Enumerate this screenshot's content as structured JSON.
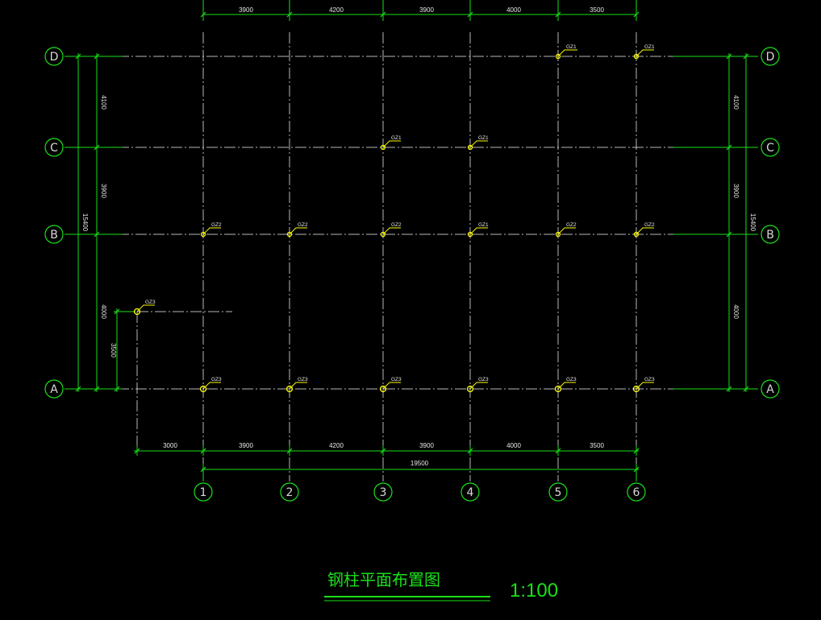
{
  "title": "钢柱平面布置图",
  "scale": "1:100",
  "axes_x": [
    "1",
    "2",
    "3",
    "4",
    "5",
    "6"
  ],
  "axes_y": [
    "A",
    "B",
    "C",
    "D"
  ],
  "dims_x": [
    "3900",
    "4200",
    "3900",
    "4000",
    "3500"
  ],
  "dim_x_extra": "3000",
  "dim_x_total": "19500",
  "dims_y": [
    "4000",
    "3900",
    "4100"
  ],
  "dim_y_total": "15400",
  "dim_gz3_offset": "3500",
  "columns": [
    {
      "label": "GZ1",
      "axis_x": "5",
      "axis_y": "D"
    },
    {
      "label": "GZ1",
      "axis_x": "6",
      "axis_y": "D"
    },
    {
      "label": "GZ1",
      "axis_x": "3",
      "axis_y": "C"
    },
    {
      "label": "GZ1",
      "axis_x": "4",
      "axis_y": "C"
    },
    {
      "label": "GZ2",
      "axis_x": "1",
      "axis_y": "B"
    },
    {
      "label": "GZ2",
      "axis_x": "2",
      "axis_y": "B"
    },
    {
      "label": "GZ2",
      "axis_x": "3",
      "axis_y": "B"
    },
    {
      "label": "GZ1",
      "axis_x": "4",
      "axis_y": "B"
    },
    {
      "label": "GZ2",
      "axis_x": "5",
      "axis_y": "B"
    },
    {
      "label": "GZ2",
      "axis_x": "6",
      "axis_y": "B"
    },
    {
      "label": "GZ3",
      "axis_x": "1",
      "axis_y": "A"
    },
    {
      "label": "GZ3",
      "axis_x": "2",
      "axis_y": "A"
    },
    {
      "label": "GZ3",
      "axis_x": "3",
      "axis_y": "A"
    },
    {
      "label": "GZ3",
      "axis_x": "4",
      "axis_y": "A"
    },
    {
      "label": "GZ3",
      "axis_x": "5",
      "axis_y": "A"
    },
    {
      "label": "GZ3",
      "axis_x": "6",
      "axis_y": "A"
    },
    {
      "label": "GZ3",
      "axis_x": "",
      "axis_y": ""
    }
  ],
  "colors": {
    "background": "#000000",
    "dimension": "#19e119",
    "column": "#ffff00",
    "axis": "#d8d8d8",
    "text": "#e8e8e8"
  }
}
